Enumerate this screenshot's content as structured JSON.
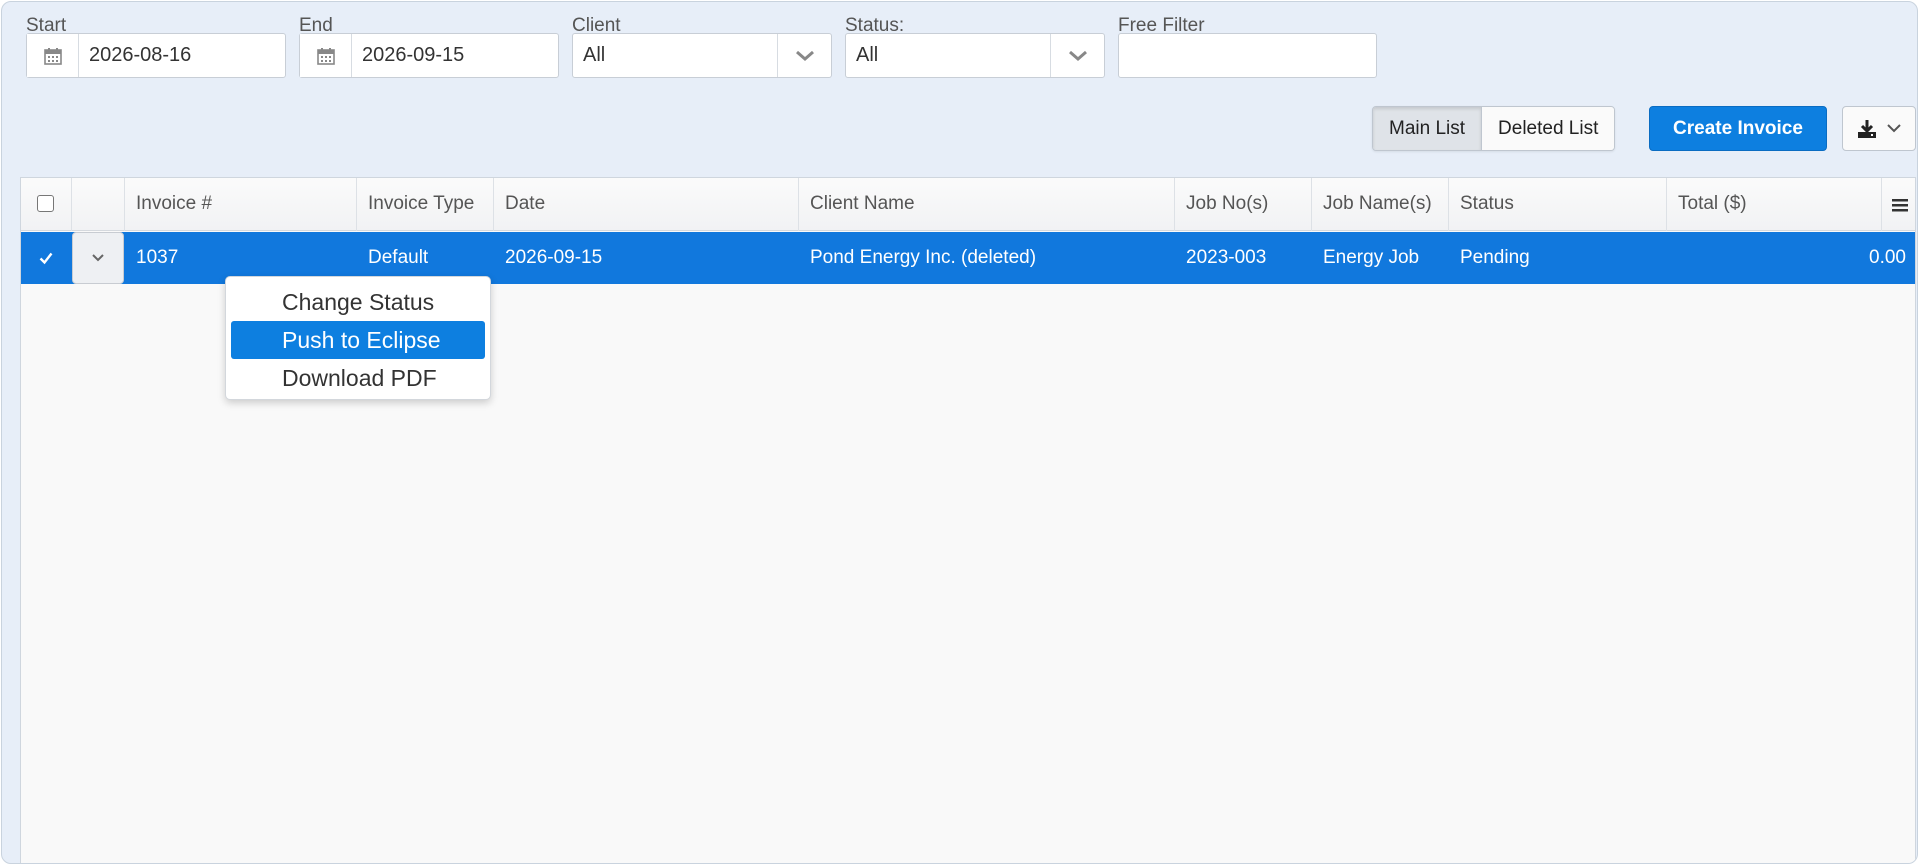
{
  "filters": {
    "start": {
      "label": "Start",
      "value": "2026-08-16"
    },
    "end": {
      "label": "End",
      "value": "2026-09-15"
    },
    "client": {
      "label": "Client",
      "value": "All"
    },
    "status": {
      "label": "Status:",
      "value": "All"
    },
    "free": {
      "label": "Free Filter",
      "value": ""
    }
  },
  "toolbar": {
    "main_list": "Main List",
    "deleted_list": "Deleted List",
    "create_invoice": "Create Invoice"
  },
  "table": {
    "columns": [
      "Invoice #",
      "Invoice Type",
      "Date",
      "Client Name",
      "Job No(s)",
      "Job Name(s)",
      "Status",
      "Total ($)"
    ],
    "rows": [
      {
        "invoice_no": "1037",
        "type": "Default",
        "date": "2026-09-15",
        "client": "Pond Energy Inc. (deleted)",
        "job_no": "2023-003",
        "job_name": "Energy Job",
        "status": "Pending",
        "total": "0.00"
      }
    ]
  },
  "row_menu": {
    "items": [
      "Change Status",
      "Push to Eclipse",
      "Download PDF"
    ],
    "highlighted": "Push to Eclipse"
  },
  "colors": {
    "accent": "#0d7fe0",
    "selected_row": "#1178dd"
  }
}
